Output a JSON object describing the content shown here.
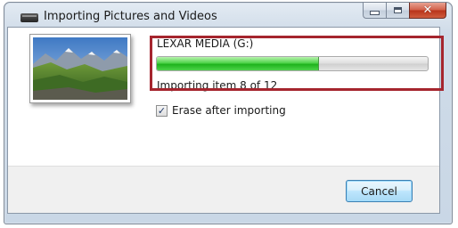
{
  "window": {
    "title": "Importing Pictures and Videos"
  },
  "import": {
    "device_name": "LEXAR MEDIA (G:)",
    "status_text": "Importing item 8 of 12",
    "progress_fraction": 0.6,
    "erase_after_importing_label": "Erase after importing",
    "erase_after_importing_checked": true
  },
  "buttons": {
    "cancel_label": "Cancel"
  },
  "icons": {
    "app": "camera-import-icon",
    "minimize": "minimize-icon",
    "maximize": "maximize-icon",
    "close": "close-icon"
  },
  "colors": {
    "progress_green": "#2bbf27",
    "highlight_red": "#a5252e"
  }
}
